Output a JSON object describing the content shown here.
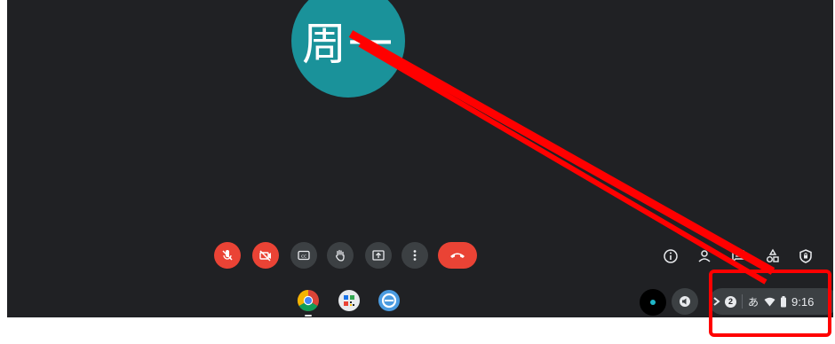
{
  "participant": {
    "avatar_text": "周一",
    "avatar_color": "#1a929a"
  },
  "call_controls": {
    "mic": "mic-off-icon",
    "camera": "camera-off-icon",
    "captions": "cc",
    "raise_hand": "hand-icon",
    "present": "present-icon",
    "more": "more-vert-icon",
    "leave": "call-end-icon"
  },
  "right_controls": [
    "info-icon",
    "people-icon",
    "chat-icon",
    "activities-icon",
    "host-controls-icon"
  ],
  "shelf": {
    "apps": [
      "chrome-icon",
      "qr-app-icon",
      "browser-app-icon"
    ]
  },
  "tray": {
    "notification_count": "2",
    "ime": "あ",
    "time": "9:16"
  },
  "colors": {
    "accent_red": "#ea4335",
    "annotation": "#ff0000",
    "background": "#202124"
  }
}
